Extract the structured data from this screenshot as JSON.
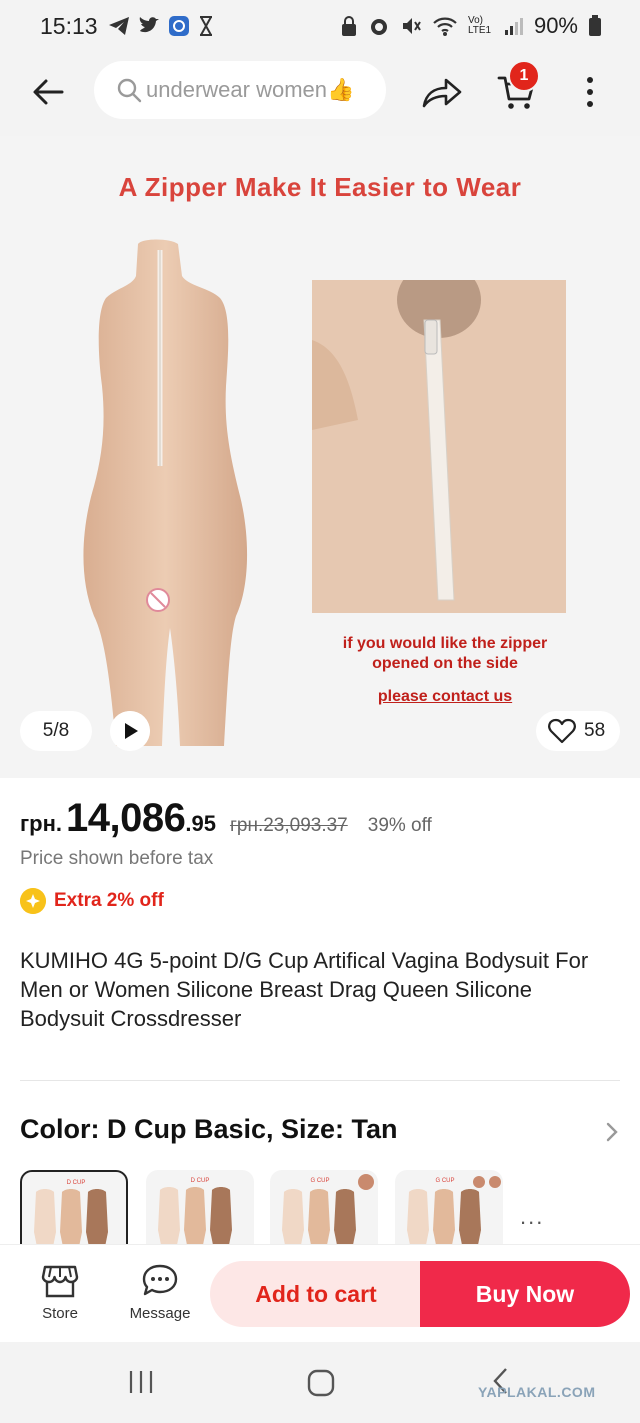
{
  "status_bar": {
    "time": "15:13",
    "battery": "90%",
    "network": "Vo) LTE1"
  },
  "nav": {
    "search_text": "underwear women👍",
    "cart_count": "1"
  },
  "hero": {
    "headline": "A Zipper Make It Easier to Wear",
    "caption_line1": "if you would like the zipper",
    "caption_line2": "opened on the side",
    "contact": "please contact us",
    "pager": "5/8",
    "likes": "58"
  },
  "price": {
    "currency": "грн.",
    "whole": "14,086",
    "decimals": ".95",
    "old": "грн.23,093.37",
    "discount": "39% off",
    "tax_note": "Price shown before tax",
    "extra": "Extra 2% off"
  },
  "product": {
    "title": "KUMIHO 4G 5-point D/G Cup Artifical Vagina Bodysuit For Men or Women Silicone Breast Drag Queen Silicone Bodysuit Crossdresser"
  },
  "variant": {
    "label": "Color: D Cup Basic, Size: Tan",
    "swatch_labels": [
      "D CUP",
      "D CUP",
      "G CUP",
      "G CUP"
    ],
    "more": "..."
  },
  "actions": {
    "store": "Store",
    "message": "Message",
    "add_to_cart": "Add to cart",
    "buy_now": "Buy Now"
  },
  "watermark": "YAPLAKAL.COM",
  "colors": {
    "accent": "#e1251b",
    "buy": "#f0294a",
    "add_bg": "#fde7e6",
    "skin": "#e4bfa3"
  }
}
